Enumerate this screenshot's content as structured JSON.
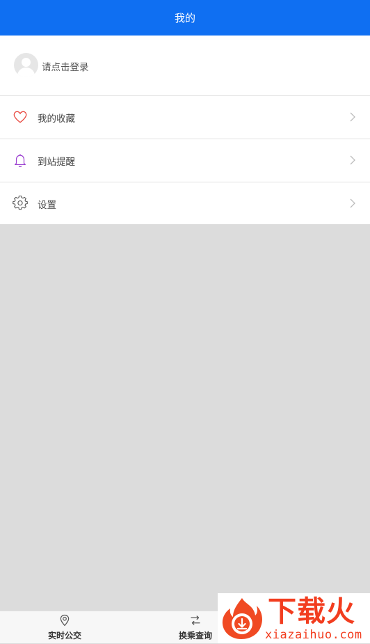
{
  "header": {
    "title": "我的"
  },
  "login": {
    "text": "请点击登录"
  },
  "menu": [
    {
      "label": "我的收藏",
      "icon": "heart-icon",
      "color": "#e8453c"
    },
    {
      "label": "到站提醒",
      "icon": "bell-icon",
      "color": "#9b3fd0"
    },
    {
      "label": "设置",
      "icon": "gear-icon",
      "color": "#555555"
    }
  ],
  "tabbar": [
    {
      "label": "实时公交",
      "icon": "location-pin-icon"
    },
    {
      "label": "换乘查询",
      "icon": "transfer-icon"
    }
  ],
  "watermark": {
    "title": "下载火",
    "subtitle": "xiazaihuo.com"
  },
  "colors": {
    "accent": "#0f6ff2",
    "background": "#dcdcdc"
  }
}
